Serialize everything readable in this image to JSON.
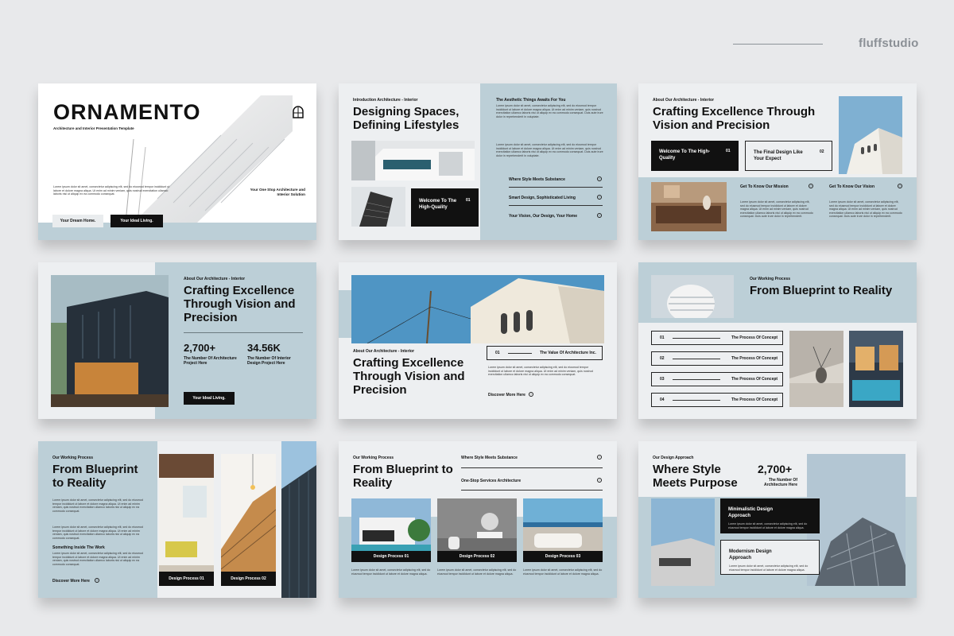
{
  "brand": "fluffstudio",
  "s1": {
    "title": "ORNAMENTO",
    "subtitle": "Architecture and Interior Presentation Template",
    "body": "Lorem ipsum dolor sit amet, consectetur adipiscing elit, sed do eiusmod tempor incididunt ut labore et dolore magna aliqua. Ut enim ad minim veniam, quis nostrud exercitation ullamco laboris nisi ut aliquip ex ea commodo consequat.",
    "tagline": "Your One Stop Architecture and Interior Solution",
    "btn1": "Your Dream Home.",
    "btn2": "Your Ideal Living."
  },
  "s2": {
    "kicker": "Introduction Architecture - Interior",
    "title": "Designing Spaces, Defining Lifestyles",
    "right_kicker": "The Aesthetic Things Awaits For You",
    "body": "Lorem ipsum dolor sit amet, consectetur adipiscing elit, sed do eiusmod tempor incididunt ut labore et dolore magna aliqua. Ut enim ad minim veniam, quis nostrud exercitation ullamco laboris nisi ut aliquip ex ea commodo consequat. Duis aute irure dolor in reprehenderit in voluptate.",
    "box_text": "Welcome To The High-Quality",
    "box_num": "01",
    "items": [
      "Where Style Meets Substance",
      "Smart Design, Sophisticated Living",
      "Your Vision, Our Design, Your Home"
    ]
  },
  "s3": {
    "kicker": "About Our Architecture - Interior",
    "title": "Crafting Excellence Through Vision and Precision",
    "box1": "Welcome To The High-Quality",
    "box1_num": "01",
    "box2": "The Final Design Like Your Expect",
    "box2_num": "02",
    "link1": "Get To Know Our Mission",
    "link2": "Get To Know Our Vision",
    "body": "Lorem ipsum dolor sit amet, consectetur adipiscing elit, sed do eiusmod tempor incididunt ut labore et dolore magna aliqua. Ut enim ad minim veniam, quis nostrud exercitation ullamco laboris nisi ut aliquip ex ea commodo consequat. Duis aute irure dolor in reprehenderit."
  },
  "s4": {
    "kicker": "About Our Architecture - Interior",
    "title": "Crafting Excellence Through Vision and Precision",
    "stat1": "2,700+",
    "stat1_label": "The Number Of Architecture Project Here",
    "stat2": "34.56K",
    "stat2_label": "The Number Of Interior Design Project Here",
    "btn": "Your Ideal Living."
  },
  "s5": {
    "kicker": "About Our Architecture - Interior",
    "title": "Crafting Excellence Through Vision and Precision",
    "num": "01",
    "row_label": "The Value Of Architecture Inc.",
    "body": "Lorem ipsum dolor sit amet, consectetur adipiscing elit, sed do eiusmod tempor incididunt ut labore et dolore magna aliqua. Ut enim ad minim veniam, quis nostrud exercitation ullamco laboris nisi ut aliquip ex ea commodo consequat.",
    "link": "Discover More Here"
  },
  "s6": {
    "kicker": "Our Working Process",
    "title": "From Blueprint to Reality",
    "rows": [
      {
        "num": "01",
        "label": "The Process Of Concept"
      },
      {
        "num": "02",
        "label": "The Process Of Concept"
      },
      {
        "num": "03",
        "label": "The Process Of Concept"
      },
      {
        "num": "04",
        "label": "The Process Of Concept"
      }
    ]
  },
  "s7": {
    "kicker": "Our Working Process",
    "title": "From Blueprint to Reality",
    "body": "Lorem ipsum dolor sit amet, consectetur adipiscing elit, sed do eiusmod tempor incididunt ut labore et dolore magna aliqua. Ut enim ad minim veniam, quis nostrud exercitation ullamco laboris nisi ut aliquip ex ea commodo consequat.",
    "sub": "Something Inside The Work",
    "link": "Discover More Here",
    "cap1": "Design Process 01",
    "cap2": "Design Process 02"
  },
  "s8": {
    "kicker": "Our Working Process",
    "title": "From Blueprint to Reality",
    "item1": "Where Style Meets Substance",
    "item2": "One-Stop Services Architecture",
    "body": "Lorem ipsum dolor sit amet, consectetur adipiscing elit, sed do eiusmod tempor incididunt ut labore et dolore magna aliqua.",
    "cap1": "Design Process 01",
    "cap2": "Design Process 02",
    "cap3": "Design Process 03"
  },
  "s9": {
    "kicker": "Our Design Approach",
    "title": "Where Style Meets Purpose",
    "stat": "2,700+",
    "stat_label": "The Number Of Architecture Here",
    "box1": "Minimalistic Design Approach",
    "box2": "Modernism Design Approach",
    "body": "Lorem ipsum dolor sit amet, consectetur adipiscing elit, sed do eiusmod tempor incididunt ut labore et dolore magna aliqua."
  }
}
